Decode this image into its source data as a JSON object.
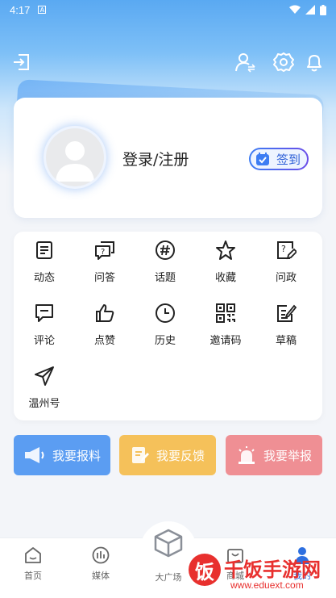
{
  "status": {
    "time": "4:17"
  },
  "profile": {
    "login_label": "登录/注册",
    "signin_label": "签到"
  },
  "grid": [
    {
      "label": "动态",
      "icon": "feed-icon"
    },
    {
      "label": "问答",
      "icon": "qa-icon"
    },
    {
      "label": "话题",
      "icon": "topic-icon"
    },
    {
      "label": "收藏",
      "icon": "star-icon"
    },
    {
      "label": "问政",
      "icon": "inquiry-icon"
    },
    {
      "label": "评论",
      "icon": "comment-icon"
    },
    {
      "label": "点赞",
      "icon": "thumb-up-icon"
    },
    {
      "label": "历史",
      "icon": "history-icon"
    },
    {
      "label": "邀请码",
      "icon": "qrcode-icon"
    },
    {
      "label": "草稿",
      "icon": "draft-icon"
    },
    {
      "label": "温州号",
      "icon": "send-icon"
    }
  ],
  "actions": [
    {
      "label": "我要报料",
      "color": "#5b9df2"
    },
    {
      "label": "我要反馈",
      "color": "#f5c15a"
    },
    {
      "label": "我要举报",
      "color": "#ef8f94"
    }
  ],
  "nav": [
    {
      "label": "首页"
    },
    {
      "label": "媒体"
    },
    {
      "label": "大广场"
    },
    {
      "label": "商城"
    },
    {
      "label": "我的"
    }
  ],
  "watermark": {
    "big": "千饭手游网",
    "small": "www.eduext.com",
    "badge": "饭"
  }
}
